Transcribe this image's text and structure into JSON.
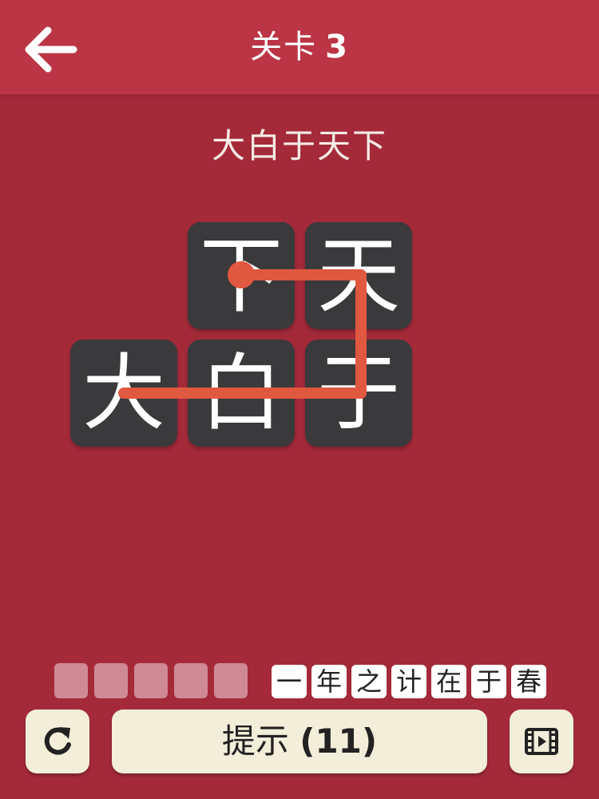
{
  "header": {
    "title": "关卡",
    "level": "3"
  },
  "target_word": "大白于天下",
  "tiles": [
    {
      "char": "下"
    },
    {
      "char": "天"
    },
    {
      "char": "大"
    },
    {
      "char": "白"
    },
    {
      "char": "于"
    }
  ],
  "answer_slots": 5,
  "next_phrase": [
    "一",
    "年",
    "之",
    "计",
    "在",
    "于",
    "春"
  ],
  "buttons": {
    "hint_label": "提示",
    "hint_count": "(11)"
  },
  "icons": {
    "back": "arrow-left-icon",
    "refresh": "refresh-icon",
    "video": "video-film-icon"
  },
  "colors": {
    "background": "#a42a3a",
    "header": "#bb3545",
    "tile": "#3a3a3c",
    "path": "#e0583f",
    "slot_empty": "#d08996",
    "button": "#f3eed9"
  }
}
